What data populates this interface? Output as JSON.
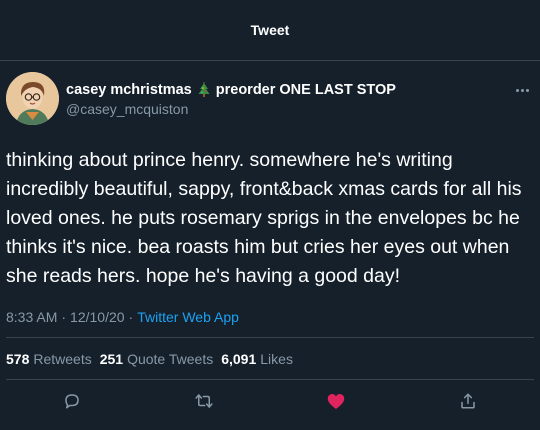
{
  "header": {
    "title": "Tweet"
  },
  "author": {
    "display_name": "casey mchristmas",
    "name_suffix": "preorder ONE LAST STOP",
    "handle": "@casey_mcquiston",
    "avatar_icon": "avatar-illustration",
    "emoji_icon": "christmas-tree-icon"
  },
  "tweet": {
    "text": "thinking about prince henry. somewhere he's writing incredibly beautiful, sappy, front&back xmas cards for all his loved ones. he puts rosemary sprigs in the envelopes bc he thinks it's nice. bea roasts him but cries her eyes out when she reads hers. hope he's having a good day!",
    "time": "8:33 AM",
    "date": "12/10/20",
    "separator": "·",
    "source": "Twitter Web App"
  },
  "stats": {
    "retweets_count": "578",
    "retweets_label": "Retweets",
    "quotes_count": "251",
    "quotes_label": "Quote Tweets",
    "likes_count": "6,091",
    "likes_label": "Likes"
  },
  "colors": {
    "background": "#15202b",
    "border": "#38444d",
    "muted": "#8899a6",
    "link": "#1da1f2",
    "like": "#e0245e"
  },
  "actions": [
    "reply-icon",
    "retweet-icon",
    "like-icon",
    "share-icon"
  ]
}
